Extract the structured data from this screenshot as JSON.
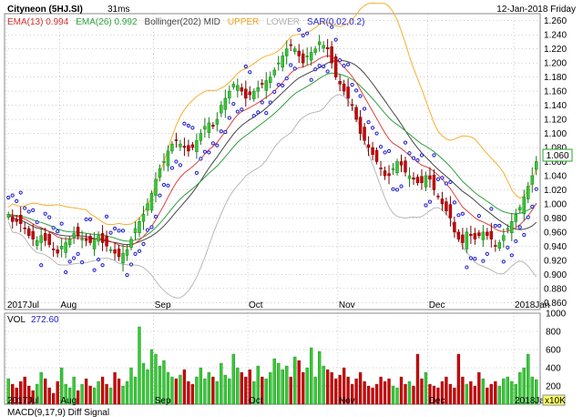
{
  "header": {
    "name": "Cityneon (5HJ.SI)",
    "timing": "31ms",
    "date": "12-Jan-2018 Friday"
  },
  "indicators": [
    {
      "label": "EMA(13)",
      "value": "0.994",
      "color": "#d03030"
    },
    {
      "label": "EMA(26)",
      "value": "0.992",
      "color": "#30a040"
    },
    {
      "label": "Bollinger(202) MID",
      "value": "",
      "color": "#444444"
    },
    {
      "label": "UPPER",
      "value": "",
      "color": "#f0a020"
    },
    {
      "label": "LOWER",
      "value": "",
      "color": "#b0b0b0"
    },
    {
      "label": "SAR(0.02,0.2)",
      "value": "",
      "color": "#2020d0"
    }
  ],
  "colors": {
    "up": "#33cc33",
    "down": "#cc0000",
    "ema13": "#e04040",
    "ema26": "#30a040",
    "mid": "#444444",
    "upper": "#f5b030",
    "lower": "#b8b8b8",
    "sar": "#1a1acc",
    "grid": "#9a9a9a",
    "last_price_box": "#22aa22"
  },
  "last_price_label": "1.060",
  "volume": {
    "label": "VOL",
    "value": "272.60",
    "multiplier_label": "x10K"
  },
  "bottom_cut_label": "MACD(9,17,9)   Diff   Signal",
  "chart_data": {
    "type": "candlestick",
    "x_ticks": [
      "2017Jul",
      "Aug",
      "Sep",
      "Oct",
      "Nov",
      "Dec",
      "2018Jan"
    ],
    "y_ticks": [
      "1.260",
      "1.240",
      "1.220",
      "1.200",
      "1.180",
      "1.160",
      "1.140",
      "1.120",
      "1.100",
      "1.080",
      "1.060",
      "1.040",
      "1.020",
      "1.000",
      "0.980",
      "0.960",
      "0.940",
      "0.920",
      "0.900",
      "0.880",
      "0.860"
    ],
    "ylim": [
      0.85,
      1.27
    ],
    "close": [
      0.985,
      0.975,
      0.975,
      0.972,
      0.965,
      0.955,
      0.95,
      0.948,
      0.955,
      0.948,
      0.942,
      0.935,
      0.93,
      0.94,
      0.945,
      0.95,
      0.958,
      0.955,
      0.95,
      0.948,
      0.945,
      0.95,
      0.955,
      0.945,
      0.94,
      0.935,
      0.93,
      0.925,
      0.93,
      0.935,
      0.95,
      0.965,
      0.975,
      0.985,
      1.0,
      1.015,
      1.035,
      1.05,
      1.06,
      1.075,
      1.085,
      1.09,
      1.085,
      1.08,
      1.075,
      1.08,
      1.09,
      1.1,
      1.11,
      1.115,
      1.11,
      1.12,
      1.14,
      1.15,
      1.16,
      1.17,
      1.168,
      1.16,
      1.15,
      1.155,
      1.16,
      1.165,
      1.17,
      1.175,
      1.18,
      1.19,
      1.2,
      1.21,
      1.22,
      1.225,
      1.22,
      1.21,
      1.2,
      1.21,
      1.215,
      1.22,
      1.23,
      1.225,
      1.22,
      1.2,
      1.18,
      1.17,
      1.16,
      1.15,
      1.14,
      1.12,
      1.1,
      1.09,
      1.08,
      1.07,
      1.06,
      1.05,
      1.04,
      1.04,
      1.05,
      1.06,
      1.055,
      1.045,
      1.04,
      1.035,
      1.03,
      1.03,
      1.04,
      1.035,
      1.02,
      1.01,
      1.0,
      0.99,
      0.98,
      0.96,
      0.95,
      0.945,
      0.96,
      0.955,
      0.95,
      0.955,
      0.96,
      0.955,
      0.95,
      0.94,
      0.945,
      0.955,
      0.965,
      0.975,
      0.985,
      0.995,
      1.01,
      1.025,
      1.04,
      1.06
    ],
    "volume": [
      28,
      22,
      18,
      25,
      30,
      20,
      15,
      22,
      35,
      28,
      18,
      12,
      25,
      40,
      22,
      18,
      30,
      15,
      22,
      28,
      20,
      18,
      25,
      30,
      22,
      18,
      35,
      28,
      20,
      25,
      40,
      30,
      85,
      45,
      38,
      60,
      55,
      42,
      48,
      35,
      30,
      28,
      32,
      38,
      25,
      22,
      30,
      40,
      28,
      35,
      30,
      25,
      45,
      32,
      28,
      55,
      40,
      35,
      30,
      38,
      25,
      42,
      30,
      28,
      35,
      50,
      45,
      38,
      42,
      30,
      52,
      48,
      35,
      40,
      62,
      30,
      58,
      42,
      38,
      35,
      28,
      32,
      40,
      30,
      22,
      28,
      35,
      25,
      20,
      18,
      22,
      30,
      25,
      28,
      20,
      18,
      30,
      22,
      25,
      20,
      55,
      28,
      35,
      22,
      20,
      18,
      25,
      30,
      22,
      18,
      55,
      30,
      22,
      25,
      20,
      35,
      28,
      18,
      22,
      25,
      20,
      28,
      30,
      25,
      22,
      35,
      40,
      55,
      30,
      27
    ]
  }
}
